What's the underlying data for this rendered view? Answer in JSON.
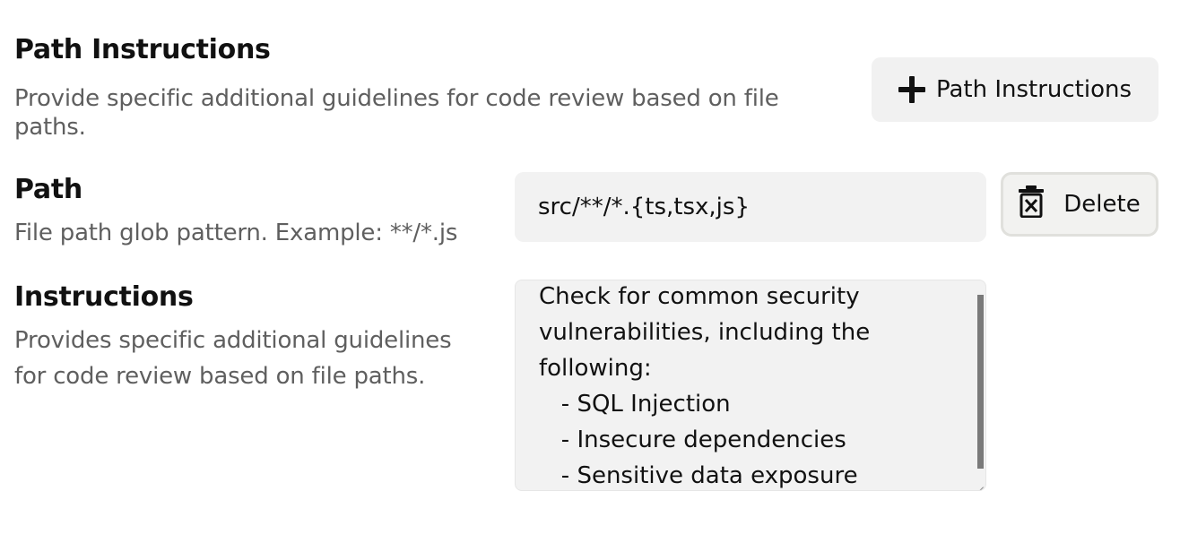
{
  "section": {
    "title": "Path Instructions",
    "description": "Provide specific additional guidelines for code review based on file paths."
  },
  "add_button": {
    "label": "Path Instructions",
    "icon": "plus-icon"
  },
  "path_field": {
    "label": "Path",
    "help": "File path glob pattern. Example: **/*.js",
    "value": "src/**/*.{ts,tsx,js}"
  },
  "delete_button": {
    "label": "Delete",
    "icon": "trash-icon"
  },
  "instructions_field": {
    "label": "Instructions",
    "help": "Provides specific additional guidelines for code review based on file paths.",
    "value": "Check for common security\nvulnerabilities, including the\nfollowing:\n   - SQL Injection\n   - Insecure dependencies\n   - Sensitive data exposure"
  }
}
